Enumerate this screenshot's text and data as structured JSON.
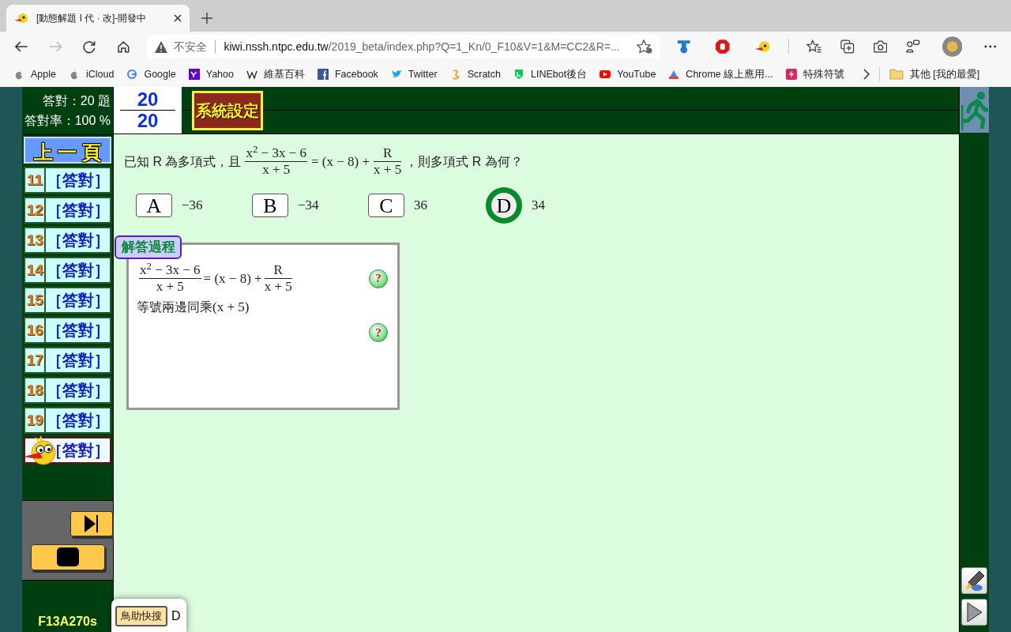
{
  "browser": {
    "tab_title": "[動態解題 I 代 · 改]-開發中",
    "security_label": "不安全",
    "url_host": "kiwi.nssh.ntpc.edu.tw",
    "url_path": "/2019_beta/index.php?Q=1_Kn/0_F10&V=1&M=CC2&R=...",
    "bookmarks": [
      {
        "kind": "apple",
        "label": "Apple"
      },
      {
        "kind": "apple",
        "label": "iCloud"
      },
      {
        "kind": "google",
        "label": "Google"
      },
      {
        "kind": "yahoo",
        "label": "Yahoo"
      },
      {
        "kind": "wiki",
        "label": "維基百科"
      },
      {
        "kind": "facebook",
        "label": "Facebook"
      },
      {
        "kind": "twitter",
        "label": "Twitter"
      },
      {
        "kind": "scratch",
        "label": "Scratch"
      },
      {
        "kind": "line",
        "label": "LINEbot後台"
      },
      {
        "kind": "youtube",
        "label": "YouTube"
      },
      {
        "kind": "chrome",
        "label": "Chrome 線上應用..."
      },
      {
        "kind": "bolt",
        "label": "特殊符號"
      }
    ],
    "other_bookmarks": "其他 [我的最愛]"
  },
  "app": {
    "score_line": "答對：20 題",
    "rate_line": "答對率：100 %",
    "score_numerator": "20",
    "score_denominator": "20",
    "settings_button": "系統設定",
    "prev_page": "上 一 頁",
    "questions": [
      {
        "number": "11",
        "status": "［答對］",
        "selected": false
      },
      {
        "number": "12",
        "status": "［答對］",
        "selected": false
      },
      {
        "number": "13",
        "status": "［答對］",
        "selected": false
      },
      {
        "number": "14",
        "status": "［答對］",
        "selected": false
      },
      {
        "number": "15",
        "status": "［答對］",
        "selected": false
      },
      {
        "number": "16",
        "status": "［答對］",
        "selected": false
      },
      {
        "number": "17",
        "status": "［答對］",
        "selected": false
      },
      {
        "number": "18",
        "status": "［答對］",
        "selected": false
      },
      {
        "number": "19",
        "status": "［答對］",
        "selected": false
      },
      {
        "status": "［答對］",
        "selected": true
      }
    ],
    "footer_code": "F13A270s",
    "question": [
      {
        "kind": "text",
        "text": "已知 R 為多項式，且"
      },
      {
        "kind": "fraction",
        "numerator": "x$^{2}$ − 3x − 6",
        "denominator": "x + 5"
      },
      {
        "kind": "math",
        "text": "= (x − 8) +"
      },
      {
        "kind": "fraction",
        "numerator": "R",
        "denominator": "x + 5"
      },
      {
        "kind": "text",
        "text": "，則多項式 R 為何？"
      }
    ],
    "options": [
      {
        "letter": "A",
        "value": "−36",
        "selected": false
      },
      {
        "letter": "B",
        "value": "−34",
        "selected": false
      },
      {
        "letter": "C",
        "value": "36",
        "selected": false
      },
      {
        "letter": "D",
        "value": "34",
        "selected": true
      }
    ],
    "solution_label": "解答過程",
    "solution_steps": [
      {
        "parts": [
          {
            "kind": "fraction",
            "numerator": "x$^{2}$ − 3x − 6",
            "denominator": "x + 5"
          },
          {
            "kind": "math",
            "text": "= (x − 8) +"
          },
          {
            "kind": "fraction",
            "numerator": "R",
            "denominator": "x + 5"
          }
        ],
        "hint": "?"
      },
      {
        "parts": [
          {
            "kind": "text",
            "text": "等號兩邊同乘"
          },
          {
            "kind": "math",
            "text": "(x + 5)"
          }
        ]
      },
      {
        "hint": "?"
      }
    ],
    "popup": {
      "button": "鳥助快搜",
      "answer": "D"
    }
  }
}
